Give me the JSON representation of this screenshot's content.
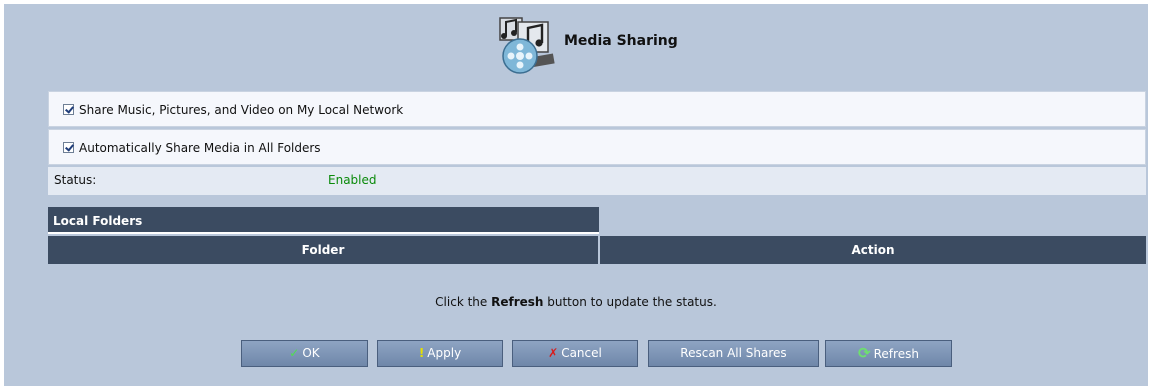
{
  "header": {
    "title": "Media Sharing",
    "icon": "media-sharing-icon"
  },
  "options": {
    "share_network": {
      "label": "Share Music, Pictures, and Video on My Local Network",
      "checked": true
    },
    "auto_share": {
      "label": "Automatically Share Media in All Folders",
      "checked": true
    }
  },
  "status": {
    "label": "Status:",
    "value": "Enabled",
    "value_color": "#0a8a0a"
  },
  "table": {
    "title": "Local Folders",
    "columns": [
      "Folder",
      "Action"
    ]
  },
  "hint": {
    "prefix": "Click the ",
    "bold": "Refresh",
    "suffix": " button to update the status."
  },
  "buttons": {
    "ok": "OK",
    "apply": "Apply",
    "cancel": "Cancel",
    "rescan": "Rescan All Shares",
    "refresh": "Refresh"
  },
  "colors": {
    "background": "#b9c7da",
    "table_header": "#3b4b61"
  }
}
